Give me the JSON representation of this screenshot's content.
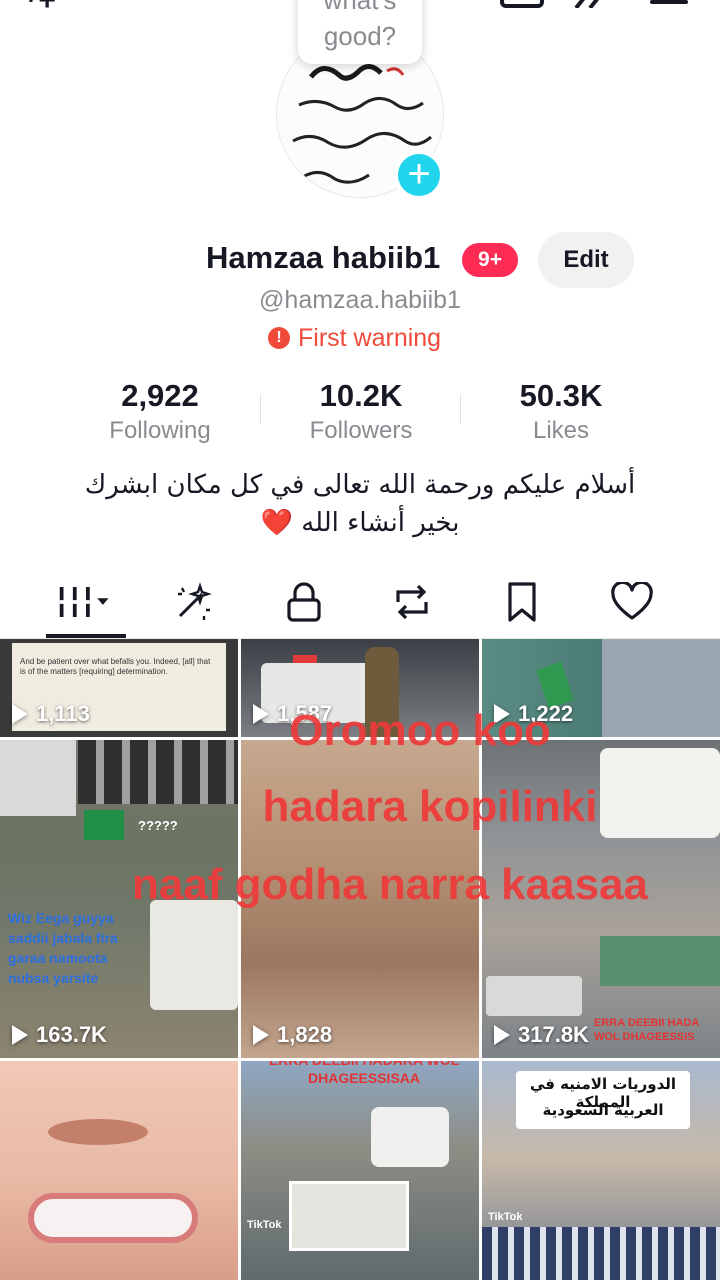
{
  "bubble": {
    "text": "what's good?"
  },
  "profile": {
    "name": "Hamzaa habiib1",
    "notif_badge": "9+",
    "edit_label": "Edit",
    "handle": "@hamzaa.habiib1",
    "warning": "First warning"
  },
  "stats": [
    {
      "value": "2,922",
      "label": "Following"
    },
    {
      "value": "10.2K",
      "label": "Followers"
    },
    {
      "value": "50.3K",
      "label": "Likes"
    }
  ],
  "bio": {
    "line1": "أسلام عليكم ورحمة الله تعالى في كل مكان ابشرك",
    "line2": "بخير أنشاء الله",
    "emoji": "❤️"
  },
  "tabs": [
    "videos-grid",
    "reposts-sparkle",
    "private-lock",
    "reposts",
    "favorites-bookmark",
    "liked-heart"
  ],
  "videos": [
    {
      "views": "1,113"
    },
    {
      "views": "1,587"
    },
    {
      "views": "1,222"
    },
    {
      "views": "163.7K"
    },
    {
      "views": "1,828"
    },
    {
      "views": "317.8K"
    }
  ],
  "overlay": {
    "line1": "Oromoo koo",
    "line2": "hadara kopilinki",
    "line3": "naaf godha narra kaasaa"
  },
  "tile_texts": {
    "t1_caption": "And be patient over what befalls you. Indeed, [all] that is of the matters [requiring] determination.",
    "t4_q": "?????",
    "t4_caption": "Wiz Eega guyya saddii jabala fira garaa namoota nubsa yarsite",
    "t6_caption": "ERRA DEEBII HADA WOL DHAGEESSIS",
    "t8_caption": "ERRA DEEBII HADARA WOL DHAGEESSISAA",
    "t9_caption1": "الدوريات الامنيه في المملكة",
    "t9_caption2": "العربية السعودية",
    "tiktok": "TikTok"
  },
  "colors": {
    "accent": "#fe2c55",
    "add": "#20d5ec",
    "warning": "#f04b3a"
  }
}
